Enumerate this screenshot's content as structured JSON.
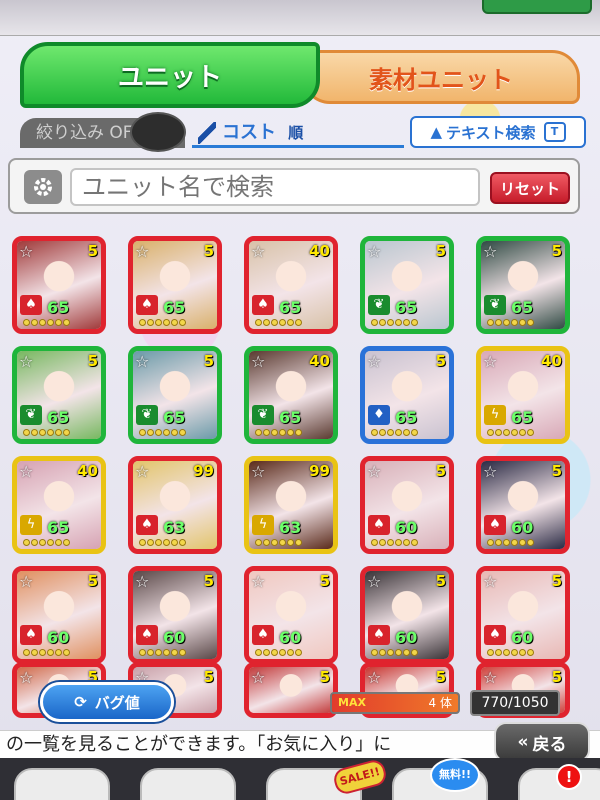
{
  "tabs": {
    "unit": "ユニット",
    "material": "素材ユニット"
  },
  "filter": {
    "narrow_label": "絞り込み OFF",
    "sort_label": "コスト",
    "sort_direction": "順",
    "text_search": "テキスト検索",
    "text_search_icon": "T"
  },
  "search": {
    "placeholder": "ユニット名で検索",
    "reset": "リセット"
  },
  "colors": {
    "red": "#e0232e",
    "green": "#1fb53b",
    "blue": "#2a72d8",
    "yellow": "#e9c314",
    "accent_blue": "#2a72d2"
  },
  "units": [
    {
      "rarity": "5",
      "level": "65",
      "color": "red",
      "type_icon": "flame-icon",
      "hue": "#a03a3a"
    },
    {
      "rarity": "5",
      "level": "65",
      "color": "red",
      "type_icon": "flame-icon",
      "hue": "#d9b06a"
    },
    {
      "rarity": "40",
      "level": "65",
      "color": "red",
      "type_icon": "flame-icon",
      "hue": "#d8c2a8"
    },
    {
      "rarity": "5",
      "level": "65",
      "color": "green",
      "type_icon": "leaf-icon",
      "hue": "#b9c6cf"
    },
    {
      "rarity": "5",
      "level": "65",
      "color": "green",
      "type_icon": "leaf-icon",
      "hue": "#2f4a43"
    },
    {
      "rarity": "5",
      "level": "65",
      "color": "green",
      "type_icon": "leaf-icon",
      "hue": "#77b860"
    },
    {
      "rarity": "5",
      "level": "65",
      "color": "green",
      "type_icon": "leaf-icon",
      "hue": "#6a9aa8"
    },
    {
      "rarity": "40",
      "level": "65",
      "color": "green",
      "type_icon": "leaf-icon",
      "hue": "#5a3a30"
    },
    {
      "rarity": "5",
      "level": "65",
      "color": "blue",
      "type_icon": "drop-icon",
      "hue": "#c9c2d0"
    },
    {
      "rarity": "40",
      "level": "65",
      "color": "yellow",
      "type_icon": "bolt-icon",
      "hue": "#d8a8b6"
    },
    {
      "rarity": "40",
      "level": "65",
      "color": "yellow",
      "type_icon": "bolt-icon",
      "hue": "#d6a2b2"
    },
    {
      "rarity": "99",
      "level": "63",
      "color": "red",
      "type_icon": "flame-icon",
      "hue": "#e2c46a"
    },
    {
      "rarity": "99",
      "level": "63",
      "color": "yellow",
      "type_icon": "bolt-icon",
      "hue": "#5a2a1a"
    },
    {
      "rarity": "5",
      "level": "60",
      "color": "red",
      "type_icon": "flame-icon",
      "hue": "#d8b0b8"
    },
    {
      "rarity": "5",
      "level": "60",
      "color": "red",
      "type_icon": "flame-icon",
      "hue": "#2a2a44"
    },
    {
      "rarity": "5",
      "level": "60",
      "color": "red",
      "type_icon": "flame-icon",
      "hue": "#e09060"
    },
    {
      "rarity": "5",
      "level": "60",
      "color": "red",
      "type_icon": "flame-icon",
      "hue": "#5a4848"
    },
    {
      "rarity": "5",
      "level": "60",
      "color": "red",
      "type_icon": "flame-icon",
      "hue": "#f0c8c0"
    },
    {
      "rarity": "5",
      "level": "60",
      "color": "red",
      "type_icon": "flame-icon",
      "hue": "#3a3438"
    },
    {
      "rarity": "5",
      "level": "60",
      "color": "red",
      "type_icon": "flame-icon",
      "hue": "#e8b8b4"
    },
    {
      "rarity": "5",
      "level": "",
      "color": "red",
      "type_icon": "flame-icon",
      "hue": "#d06a4a"
    },
    {
      "rarity": "5",
      "level": "",
      "color": "red",
      "type_icon": "flame-icon",
      "hue": "#c8a0a8"
    },
    {
      "rarity": "5",
      "level": "",
      "color": "red",
      "type_icon": "flame-icon",
      "hue": "#c23a3a"
    },
    {
      "rarity": "5",
      "level": "",
      "color": "red",
      "type_icon": "flame-icon",
      "hue": "#c8342e"
    },
    {
      "rarity": "5",
      "level": "",
      "color": "red",
      "type_icon": "flame-icon",
      "hue": "#d0403a"
    }
  ],
  "bottom": {
    "bug_button": "バグ値",
    "max_label": "MAX",
    "count": "4 体",
    "capacity": "770/1050",
    "max_fill": 1.0
  },
  "ticker": "の一覧を見ることができます。「お気に入り」に",
  "back_button": "戻る",
  "footer": {
    "sale": "SALE!!",
    "free": "無料!!",
    "alert": "!"
  }
}
